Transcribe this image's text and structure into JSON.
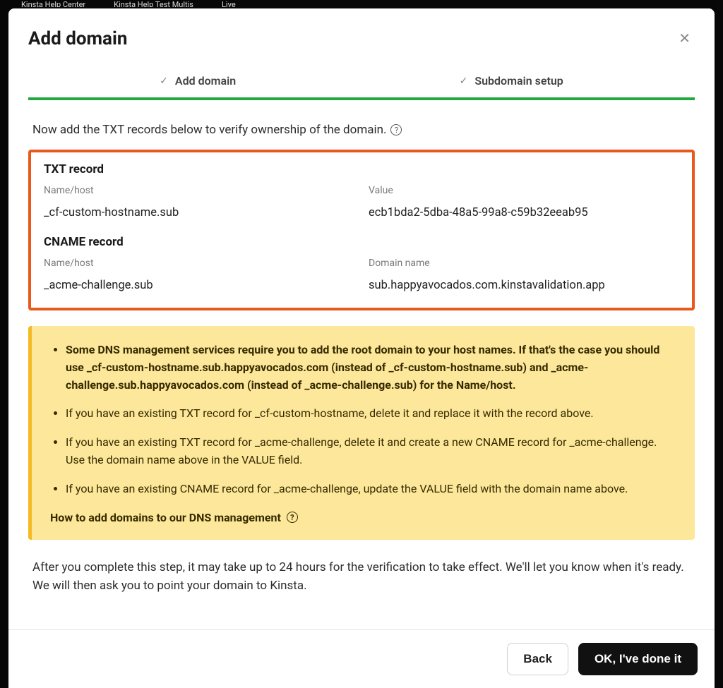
{
  "background_tabs": [
    "Kinsta Help Center",
    "Kinsta Help Test Multis",
    "Live"
  ],
  "modal": {
    "title": "Add domain",
    "steps": [
      {
        "label": "Add domain"
      },
      {
        "label": "Subdomain setup"
      }
    ],
    "intro": "Now add the TXT records below to verify ownership of the domain.",
    "records": {
      "txt": {
        "title": "TXT record",
        "name_label": "Name/host",
        "name_value": "_cf-custom-hostname.sub",
        "value_label": "Value",
        "value_value": "ecb1bda2-5dba-48a5-99a8-c59b32eeab95"
      },
      "cname": {
        "title": "CNAME record",
        "name_label": "Name/host",
        "name_value": "_acme-challenge.sub",
        "value_label": "Domain name",
        "value_value": "sub.happyavocados.com.kinstavalidation.app"
      }
    },
    "alert": {
      "items": [
        "Some DNS management services require you to add the root domain to your host names. If that's the case you should use _cf-custom-hostname.sub.happyavocados.com (instead of _cf-custom-hostname.sub) and _acme-challenge.sub.happyavocados.com (instead of _acme-challenge.sub) for the Name/host.",
        "If you have an existing TXT record for _cf-custom-hostname, delete it and replace it with the record above.",
        "If you have an existing TXT record for _acme-challenge, delete it and create a new CNAME record for _acme-challenge. Use the domain name above in the VALUE field.",
        "If you have an existing CNAME record for _acme-challenge, update the VALUE field with the domain name above."
      ],
      "link": "How to add domains to our DNS management"
    },
    "outro": "After you complete this step, it may take up to 24 hours for the verification to take effect. We'll let you know when it's ready. We will then ask you to point your domain to Kinsta.",
    "footer": {
      "back": "Back",
      "done": "OK, I've done it"
    }
  }
}
